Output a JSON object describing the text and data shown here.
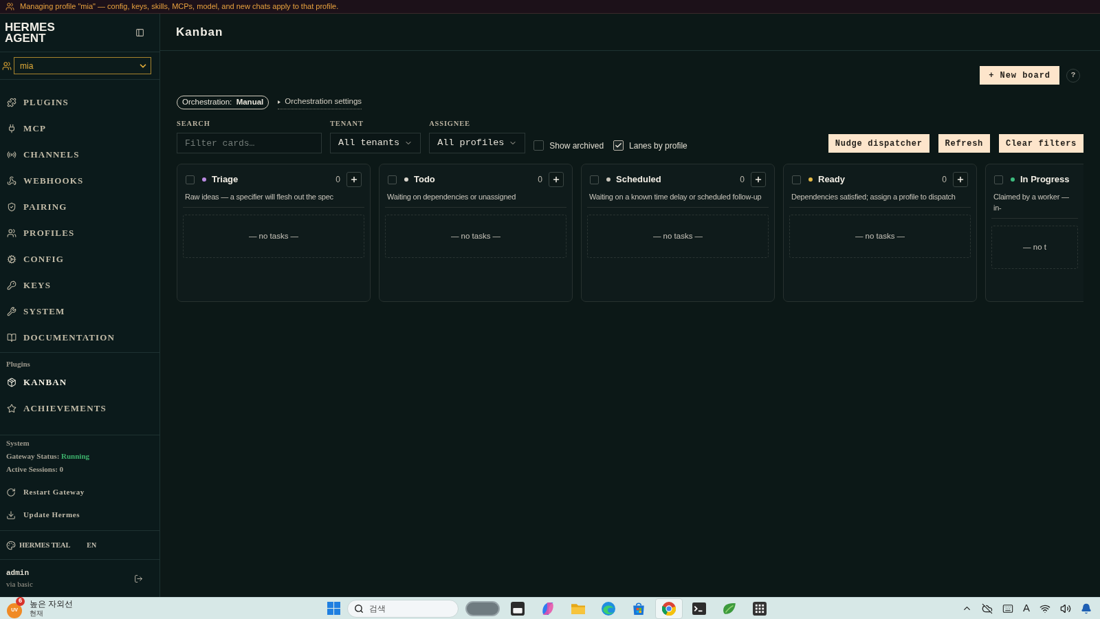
{
  "banner": {
    "text": "Managing profile \"mia\" — config, keys, skills, MCPs, model, and new chats apply to that profile."
  },
  "sidebar": {
    "brand": "HERMES AGENT",
    "profile_select": {
      "value": "mia"
    },
    "nav": [
      {
        "label": "PLUGINS",
        "selected": false
      },
      {
        "label": "MCP",
        "selected": false
      },
      {
        "label": "CHANNELS",
        "selected": false
      },
      {
        "label": "WEBHOOKS",
        "selected": false
      },
      {
        "label": "PAIRING",
        "selected": false
      },
      {
        "label": "PROFILES",
        "selected": false
      },
      {
        "label": "CONFIG",
        "selected": false
      },
      {
        "label": "KEYS",
        "selected": false
      },
      {
        "label": "SYSTEM",
        "selected": false
      },
      {
        "label": "DOCUMENTATION",
        "selected": false
      }
    ],
    "plugins": {
      "heading": "Plugins",
      "items": [
        {
          "label": "KANBAN",
          "selected": true
        },
        {
          "label": "ACHIEVEMENTS",
          "selected": false
        }
      ]
    },
    "system": {
      "heading": "System",
      "gateway_label": "Gateway Status:",
      "gateway_status": "Running",
      "sessions": "Active Sessions: **0**",
      "actions": [
        {
          "label": "Restart Gateway"
        },
        {
          "label": "Update Hermes"
        }
      ]
    },
    "theme": {
      "name": "HERMES TEAL",
      "language": "EN"
    },
    "user": {
      "name": "admin",
      "auth": "via basic"
    }
  },
  "header": {
    "title": "Kanban",
    "new_board": "+ New board",
    "help": "?"
  },
  "orchestration": {
    "label": "Orchestration:",
    "mode": "Manual",
    "settings_link": "Orchestration settings",
    "settings_expanded": false
  },
  "filters": {
    "search": {
      "label": "SEARCH",
      "placeholder": "Filter cards…"
    },
    "tenant": {
      "label": "TENANT",
      "value": "All tenants"
    },
    "assignee": {
      "label": "ASSIGNEE",
      "value": "All profiles"
    },
    "toggles": [
      {
        "label": "Show archived",
        "checked": false
      },
      {
        "label": "Lanes by profile",
        "checked": true
      }
    ],
    "buttons": [
      "Nudge dispatcher",
      "Refresh",
      "Clear filters"
    ]
  },
  "lanes": [
    {
      "title": "Triage",
      "color": "#b98ae0",
      "checked": false,
      "count": "0",
      "description": "Raw ideas — a specifier will flesh out the spec",
      "empty": "— no tasks —"
    },
    {
      "title": "Todo",
      "color": "#d9d5cc",
      "checked": false,
      "count": "0",
      "description": "Waiting on dependencies or unassigned",
      "empty": "— no tasks —"
    },
    {
      "title": "Scheduled",
      "color": "#c9c5bb",
      "checked": false,
      "count": "0",
      "description": "Waiting on a known time delay or scheduled follow-up",
      "empty": "— no tasks —"
    },
    {
      "title": "Ready",
      "color": "#e2b846",
      "checked": false,
      "count": "0",
      "description": "Dependencies satisfied; assign a profile to dispatch",
      "empty": "— no tasks —"
    },
    {
      "title": "In Progress",
      "color": "#3dbb7e",
      "checked": false,
      "description": "Claimed by a worker — in-",
      "empty": "— no t"
    }
  ],
  "taskbar": {
    "weather": {
      "badge": "6",
      "icon_label": "UV",
      "title": "높은 자외선",
      "subtitle": "현재"
    },
    "search": {
      "placeholder": "검색"
    },
    "apps": [
      {
        "active": false
      },
      {
        "active": false
      },
      {
        "active": false
      },
      {
        "active": false
      },
      {
        "active": false
      },
      {
        "active": true
      },
      {
        "active": false
      },
      {
        "active": false
      },
      {
        "active": false
      }
    ],
    "ime": "A"
  }
}
